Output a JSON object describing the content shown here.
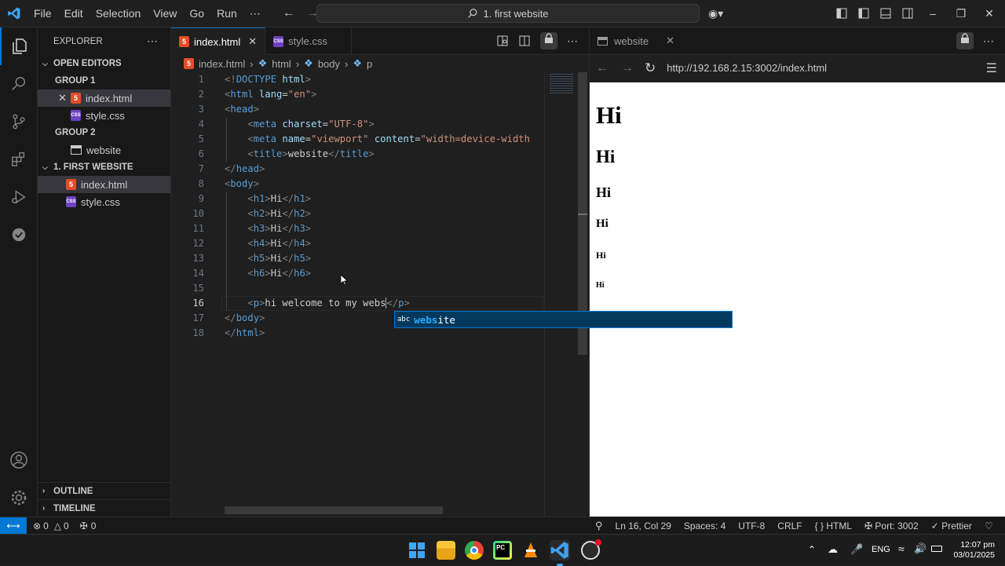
{
  "titlebar": {
    "menus": [
      "File",
      "Edit",
      "Selection",
      "View",
      "Go",
      "Run",
      "⋯"
    ],
    "search": "1. first website"
  },
  "explorer": {
    "title": "EXPLORER",
    "open_editors": "OPEN EDITORS",
    "group1": "GROUP 1",
    "group1_files": [
      "index.html",
      "style.css"
    ],
    "group2": "GROUP 2",
    "group2_files": [
      "website"
    ],
    "folder": "1. FIRST WEBSITE",
    "folder_files": [
      "index.html",
      "style.css"
    ],
    "outline": "OUTLINE",
    "timeline": "TIMELINE"
  },
  "tabs": [
    "index.html",
    "style.css"
  ],
  "breadcrumb": [
    "index.html",
    "html",
    "body",
    "p"
  ],
  "code": {
    "cursor_line": 16,
    "line_numbers": [
      "1",
      "2",
      "3",
      "4",
      "5",
      "6",
      "7",
      "8",
      "9",
      "10",
      "11",
      "12",
      "13",
      "14",
      "15",
      "16",
      "17",
      "18"
    ]
  },
  "suggest": {
    "icon": "abc",
    "match": "webs",
    "rest": "ite"
  },
  "browser": {
    "tab_title": "website",
    "url": "http://192.168.2.15:3002/index.html",
    "headings": [
      "Hi",
      "Hi",
      "Hi",
      "Hi",
      "Hi",
      "Hi"
    ]
  },
  "status": {
    "errors": "0",
    "warnings": "0",
    "ports": "0",
    "position": "Ln 16, Col 29",
    "spaces": "Spaces: 4",
    "encoding": "UTF-8",
    "eol": "CRLF",
    "language": "HTML",
    "port": "Port: 3002",
    "formatter": "Prettier"
  },
  "taskbar": {
    "lang": "ENG",
    "time": "12:07 pm",
    "date": "03/01/2025"
  },
  "colors": {
    "accent": "#0078d4",
    "tag": "#569cd6",
    "attr": "#9cdcfe",
    "string": "#ce9178",
    "html_badge": "#e44d26",
    "css_badge": "#6f42c1"
  }
}
